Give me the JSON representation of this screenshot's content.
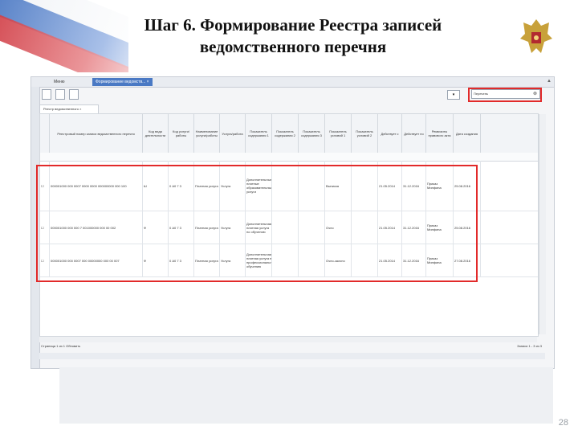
{
  "slide": {
    "title_line1": "Шаг 6. Формирование Реестра записей",
    "title_line2": "ведомственного перечня",
    "page_number": "28"
  },
  "app": {
    "tab_home": "Меню",
    "tab_registry": "Формирование ведомств... ×",
    "search_value": "Перечень",
    "subtab": "Реестр ведомственного ×",
    "filter_button": "Фильтр",
    "columns": [
      "Реестровый номер записи ведомственного перечня",
      "Код вида деятельности",
      "Код услуги/работы",
      "Наименование услуги/работы",
      "Услуга/работа",
      "Показатель содержания 1",
      "Показатель содержания 2",
      "Показатель содержания 3",
      "Показатель условий 1",
      "Показатель условий 2",
      "Действует с",
      "Действует по",
      "Реквизиты правового акта",
      "Дата создания"
    ],
    "rows": [
      {
        "id": "000001000 000 0007 0000 0000 000000000 000 100",
        "kind": "Ш",
        "code": "0 А0 7 3",
        "name": "Платная услуга",
        "type": "Услуга",
        "content1": "Дополнительные платные образовательные услуги",
        "cond1": "Выписка",
        "from": "21.05.2014",
        "to": "31.12.2016",
        "act": "Приказ Минфина",
        "created": "25.08.2016"
      },
      {
        "id": "000001000 000 000 7 001000000 000 00 002",
        "kind": "Ф",
        "code": "0 А0 7 3",
        "name": "Платная услуга",
        "type": "Услуга",
        "content1": "Дополнительная платная услуга по обучению",
        "cond1": "Очно",
        "from": "21.05.2014",
        "to": "31.12.2016",
        "act": "Приказ Минфина",
        "created": "25.08.2016"
      },
      {
        "id": "000001000 000 0007 000 00000000 000 00 007",
        "kind": "Ф",
        "code": "0 А0 7 3",
        "name": "Платная услуга",
        "type": "Услуга",
        "content1": "Дополнительная платная услуга по профессиональному обучению",
        "cond1": "Очно-заочно",
        "from": "21.05.2014",
        "to": "31.12.2016",
        "act": "Приказ Минфина",
        "created": "27.08.2016"
      }
    ],
    "pager_left": "Страница 1 из 1  Обновить",
    "pager_right": "Записи 1 - 3 из 3"
  },
  "colors": {
    "accent": "#4a79c4",
    "highlight": "#e22a2a"
  }
}
